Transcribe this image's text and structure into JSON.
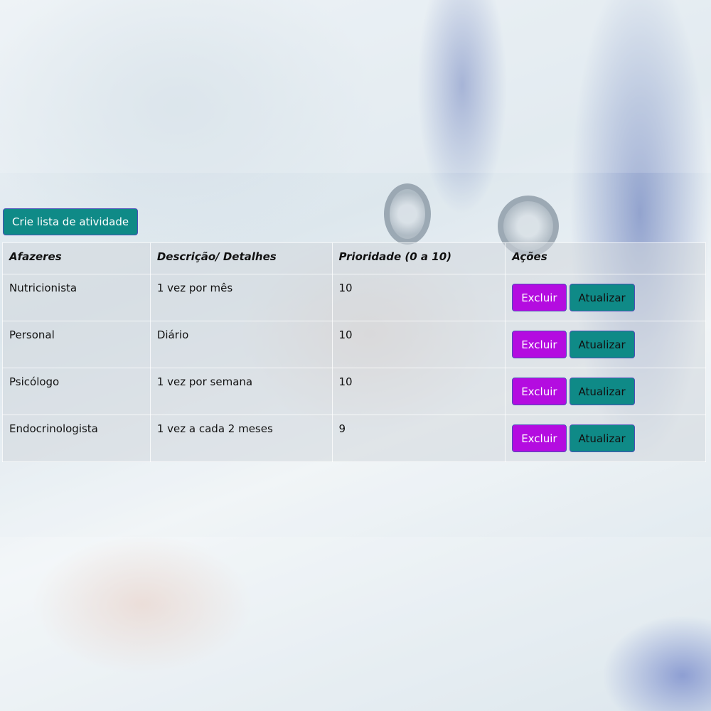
{
  "create_button_label": "Crie lista de atividade",
  "table": {
    "headers": [
      "Afazeres",
      "Descrição/ Detalhes",
      "Prioridade (0 a 10)",
      "Ações"
    ],
    "rows": [
      {
        "task": "Nutricionista",
        "details": "1 vez por mês",
        "priority": "10"
      },
      {
        "task": "Personal",
        "details": "Diário",
        "priority": "10"
      },
      {
        "task": "Psicólogo",
        "details": "1 vez por semana",
        "priority": "10"
      },
      {
        "task": "Endocrinologista",
        "details": "1 vez a cada 2 meses",
        "priority": "9"
      }
    ],
    "delete_label": "Excluir",
    "update_label": "Atualizar"
  },
  "colors": {
    "primary_teal": "#0f8a87",
    "delete_purple": "#b40ce0",
    "button_border": "#4b4fb8"
  }
}
